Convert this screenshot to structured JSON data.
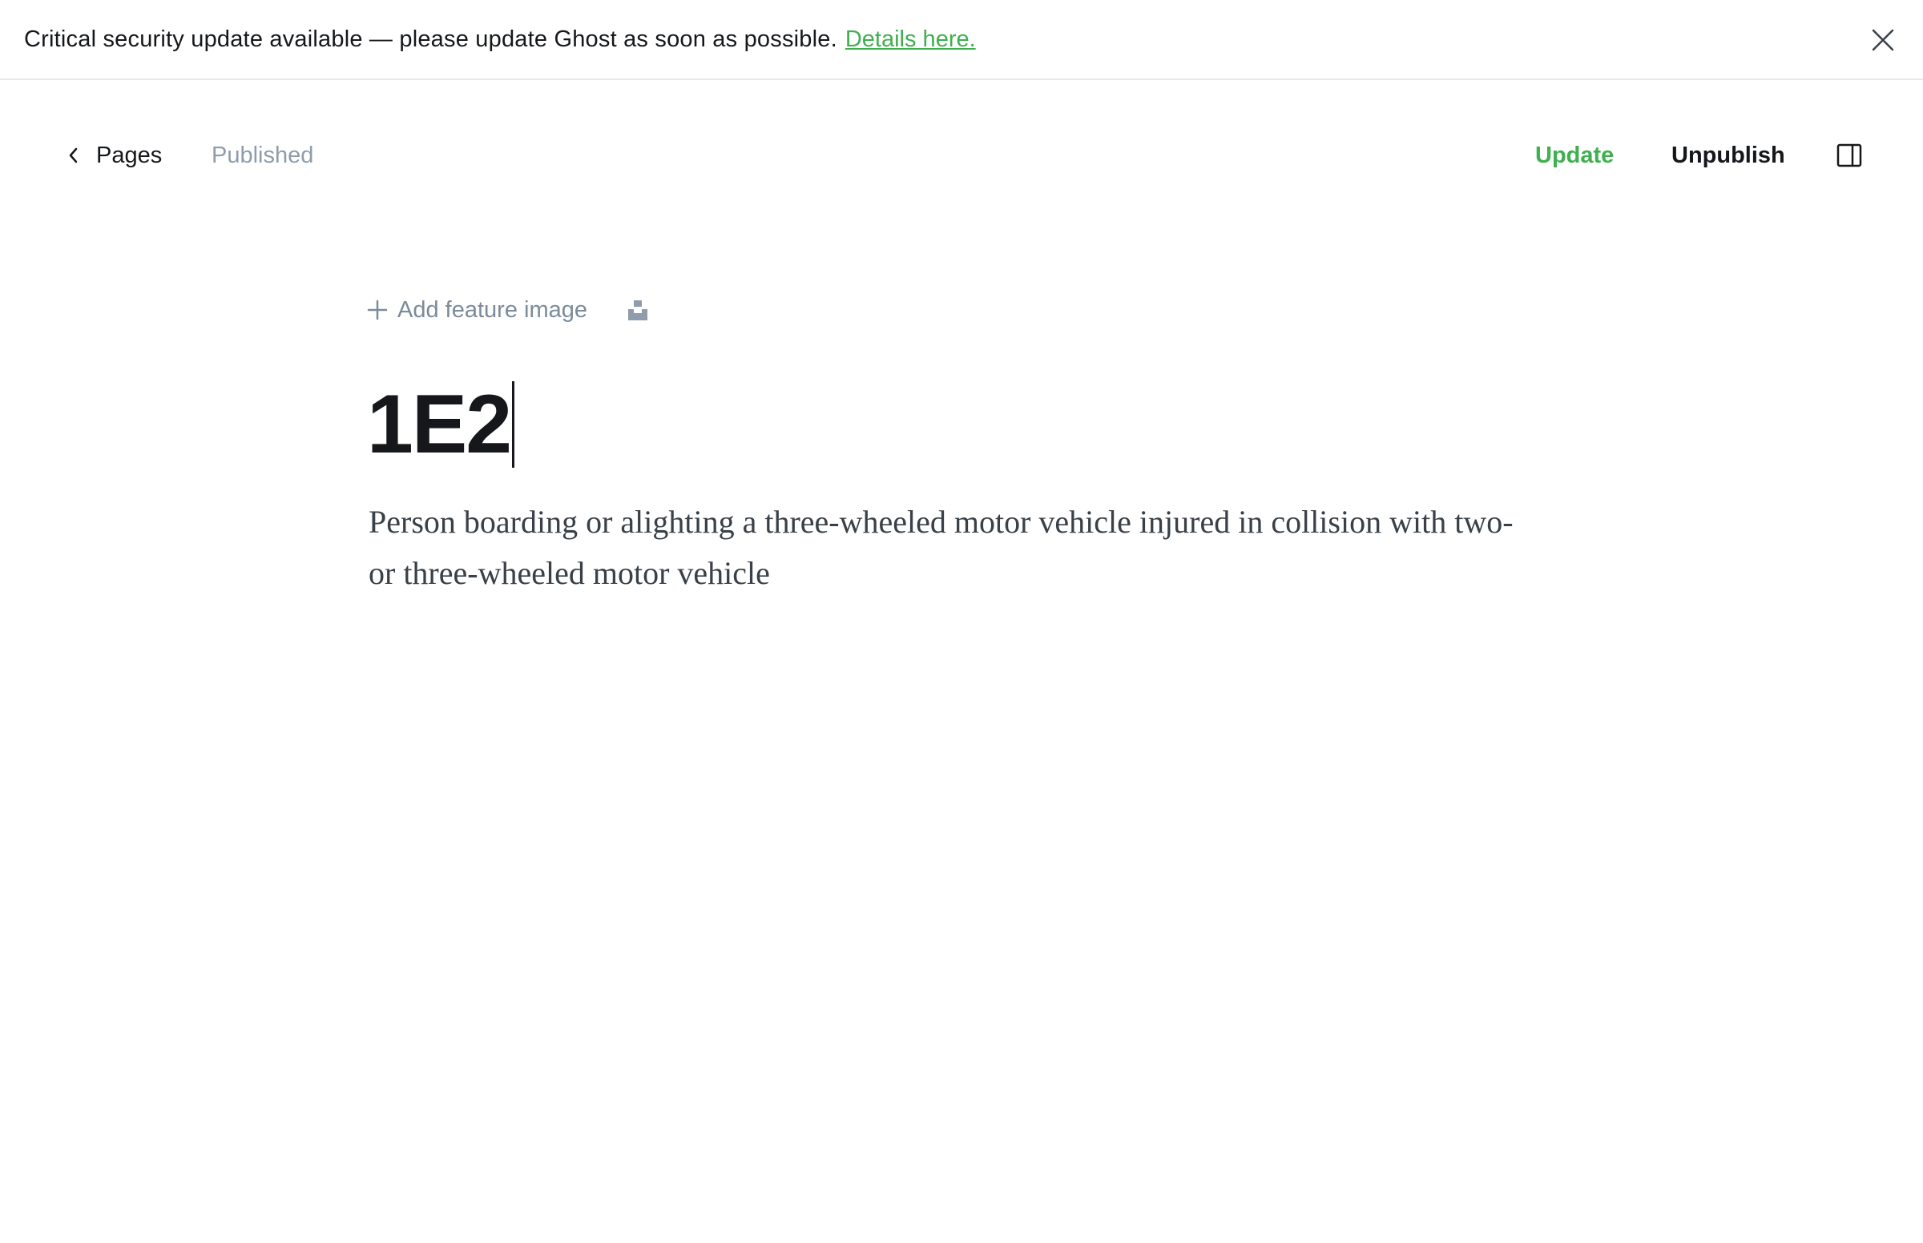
{
  "banner": {
    "message": "Critical security update available — please update Ghost as soon as possible.",
    "link_text": "Details here.",
    "close_icon": "close-icon"
  },
  "topbar": {
    "back_label": "Pages",
    "status": "Published",
    "update_label": "Update",
    "unpublish_label": "Unpublish",
    "sidebar_icon": "sidebar-toggle-icon"
  },
  "editor": {
    "feature_image_label": "Add feature image",
    "title": "1E2",
    "body": "Person boarding or alighting a three-wheeled motor vehicle injured in collision with two- or three-wheeled motor vehicle"
  },
  "colors": {
    "accent_green": "#3eb04e",
    "muted": "#8e9cac",
    "text": "#15171a"
  }
}
